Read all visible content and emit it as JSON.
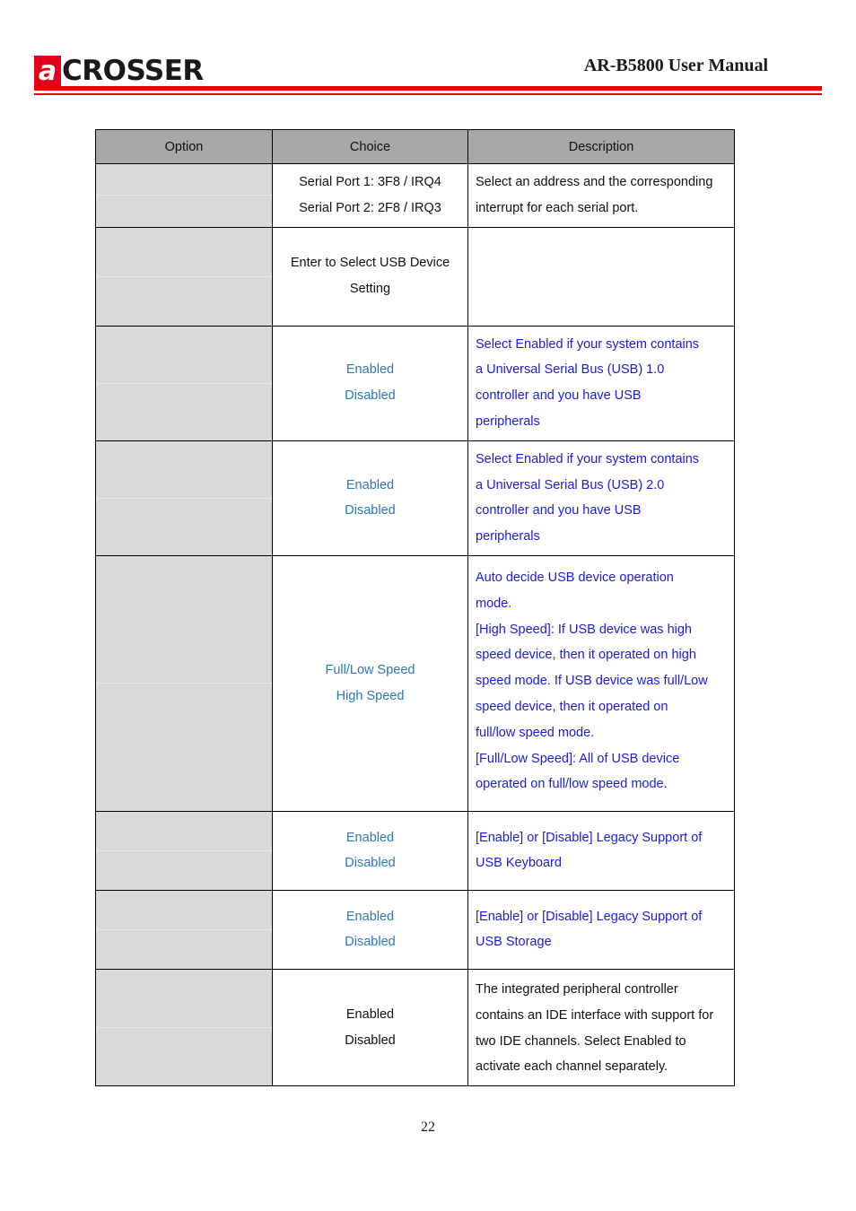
{
  "header": {
    "logo_mark_letter": "a",
    "logo_word": "CROSSER",
    "manual_title": "AR-B5800 User Manual",
    "logo_accent_color": "#e2001a",
    "rule_color": "#ee0000"
  },
  "footer": {
    "page_number": "22"
  },
  "table": {
    "columns": [
      "Option",
      "Choice",
      "Description"
    ],
    "header_bg": "#a8a8a8",
    "option_cell_bg": "#d9d9d9",
    "blue_text_color": "#1b1be0",
    "choice_blue_color": "#2b77bd",
    "rows": [
      {
        "option": "",
        "choice_lines": [
          "Serial Port 1: 3F8 / IRQ4",
          "Serial Port 2: 2F8 / IRQ3"
        ],
        "choice_color": "black",
        "desc_lines": [
          "Select an address and the corresponding",
          "interrupt for each serial port."
        ],
        "desc_color": "black"
      },
      {
        "option": "",
        "choice_lines": [
          "Enter to Select USB Device",
          "Setting"
        ],
        "choice_color": "black",
        "desc_lines": [],
        "desc_color": "black"
      },
      {
        "option": "",
        "choice_lines": [
          "Enabled",
          "Disabled"
        ],
        "choice_color": "blue",
        "desc_lines": [
          "Select Enabled if your system contains",
          "a Universal Serial Bus (USB) 1.0",
          "controller and you have USB",
          "peripherals"
        ],
        "desc_color": "blue"
      },
      {
        "option": "",
        "choice_lines": [
          "Enabled",
          "Disabled"
        ],
        "choice_color": "blue",
        "desc_lines": [
          "Select Enabled if your system contains",
          "a Universal Serial Bus (USB) 2.0",
          "controller and you have USB",
          "peripherals"
        ],
        "desc_color": "blue"
      },
      {
        "option": "",
        "choice_lines": [
          "Full/Low Speed",
          "High Speed"
        ],
        "choice_color": "blue",
        "desc_lines": [
          "Auto decide USB device operation",
          "mode.",
          "[High Speed]: If USB device was high",
          "speed device, then it operated on high",
          "speed mode. If USB device was full/Low",
          "speed device, then it operated on",
          "full/low speed mode.",
          "[Full/Low Speed]: All of USB device",
          "operated on full/low speed mode."
        ],
        "desc_color": "blue"
      },
      {
        "option": "",
        "choice_lines": [
          "Enabled",
          "Disabled"
        ],
        "choice_color": "blue",
        "desc_lines": [
          "[Enable] or [Disable] Legacy Support of",
          "USB Keyboard"
        ],
        "desc_color": "blue"
      },
      {
        "option": "",
        "choice_lines": [
          "Enabled",
          "Disabled"
        ],
        "choice_color": "blue",
        "desc_lines": [
          "[Enable] or [Disable] Legacy Support of",
          "USB Storage"
        ],
        "desc_color": "blue"
      },
      {
        "option": "",
        "choice_lines": [
          "Enabled",
          "Disabled"
        ],
        "choice_color": "black",
        "desc_lines": [
          "The integrated peripheral controller",
          "contains an IDE interface with support for",
          "two IDE channels. Select Enabled to",
          "activate each channel separately."
        ],
        "desc_color": "black"
      }
    ]
  }
}
